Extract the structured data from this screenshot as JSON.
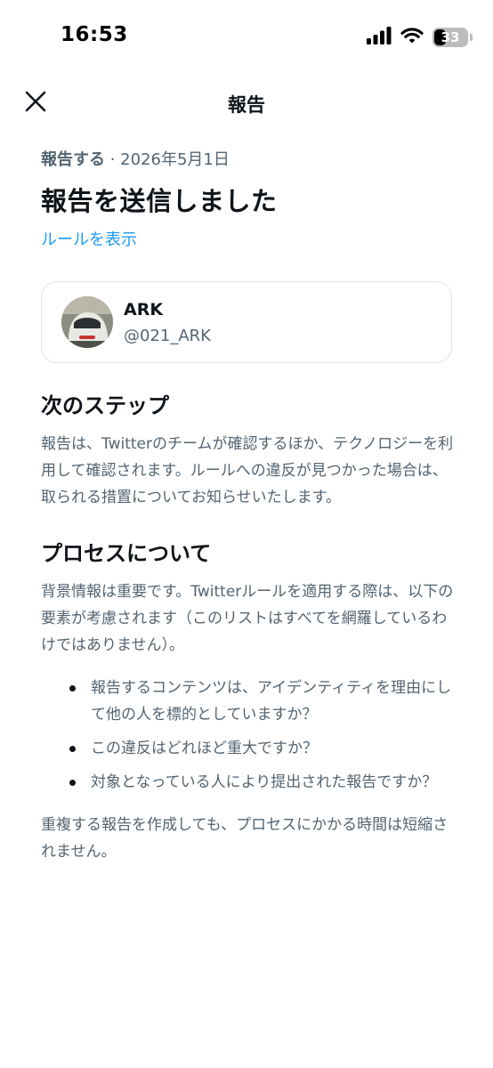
{
  "status_bar": {
    "time": "16:53",
    "battery_level": "33"
  },
  "nav": {
    "title": "報告"
  },
  "report": {
    "meta_label": "報告する",
    "meta_separator": " · ",
    "meta_date": "2026年5月1日",
    "headline": "報告を送信しました",
    "rules_link": "ルールを表示"
  },
  "account": {
    "name": "ARK",
    "handle": "@021_ARK"
  },
  "next_steps": {
    "title": "次のステップ",
    "body": "報告は、Twitterのチームが確認するほか、テクノロジーを利用して確認されます。ルールへの違反が見つかった場合は、取られる措置についてお知らせいたします。"
  },
  "process": {
    "title": "プロセスについて",
    "body": "背景情報は重要です。Twitterルールを適用する際は、以下の要素が考慮されます（このリストはすべてを網羅しているわけではありません）。",
    "bullets": [
      "報告するコンテンツは、アイデンティティを理由にして他の人を標的としていますか？",
      "この違反はどれほど重大ですか？",
      "対象となっている人により提出された報告ですか？"
    ],
    "closing": "重複する報告を作成しても、プロセスにかかる時間は短縮されません。"
  },
  "colors": {
    "link": "#1d9bf0",
    "secondary_text": "#536471",
    "primary_text": "#0f1419"
  }
}
